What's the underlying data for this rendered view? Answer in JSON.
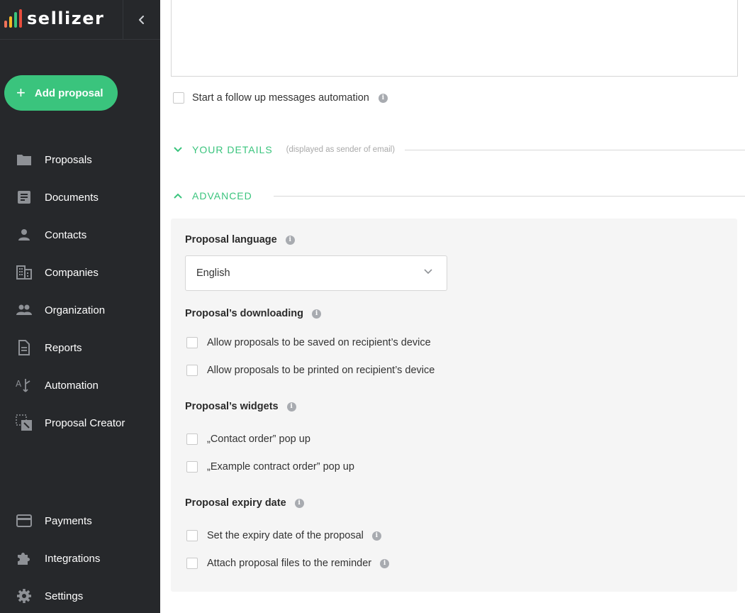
{
  "brand": {
    "name": "sellizer",
    "bar_colors": [
      "#3ac47d",
      "#f7b924",
      "#f0735a",
      "#e74c3c"
    ]
  },
  "colors": {
    "accent": "#3ac47d",
    "sidebar_bg": "#26282b",
    "panel_bg": "#f5f5f5"
  },
  "sidebar": {
    "add_button": "Add proposal",
    "items": [
      {
        "label": "Proposals",
        "icon": "folder-icon"
      },
      {
        "label": "Documents",
        "icon": "document-icon"
      },
      {
        "label": "Contacts",
        "icon": "person-icon"
      },
      {
        "label": "Companies",
        "icon": "building-icon"
      },
      {
        "label": "Organization",
        "icon": "people-icon"
      },
      {
        "label": "Reports",
        "icon": "report-icon"
      },
      {
        "label": "Automation",
        "icon": "automation-icon"
      },
      {
        "label": "Proposal Creator",
        "icon": "creator-icon"
      }
    ],
    "bottom_items": [
      {
        "label": "Payments",
        "icon": "credit-card-icon"
      },
      {
        "label": "Integrations",
        "icon": "puzzle-icon"
      },
      {
        "label": "Settings",
        "icon": "gear-icon"
      }
    ]
  },
  "main": {
    "follow_up_label": "Start a follow up messages automation",
    "your_details": {
      "title": "YOUR DETAILS",
      "subtitle": "(displayed as sender of email)"
    },
    "advanced": {
      "title": "ADVANCED",
      "language": {
        "label": "Proposal language",
        "selected": "English"
      },
      "downloading": {
        "label": "Proposal’s downloading",
        "options": [
          "Allow proposals to be saved on recipient’s device",
          "Allow proposals to be printed on recipient’s device"
        ]
      },
      "widgets": {
        "label": "Proposal’s widgets",
        "options": [
          "„Contact order” pop up",
          "„Example contract order” pop up"
        ]
      },
      "expiry": {
        "label": "Proposal expiry date",
        "options": [
          "Set the expiry date of the proposal",
          "Attach proposal files to the reminder"
        ]
      }
    }
  }
}
